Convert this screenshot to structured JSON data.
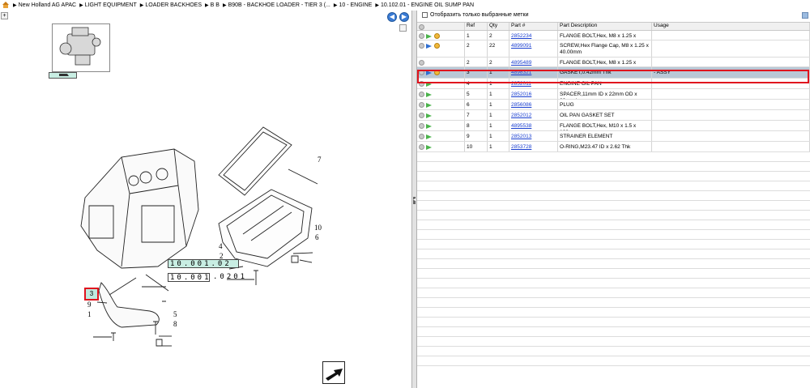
{
  "breadcrumb": [
    "New Holland AG APAC",
    "LIGHT EQUIPMENT",
    "LOADER BACKHOES",
    "B B",
    "B90B - BACKHOE LOADER - TIER 3 (...",
    "10 - ENGINE",
    "10.102.01 - ENGINE OIL SUMP PAN"
  ],
  "filter": {
    "label": "Отобразить только выбранные метки",
    "checked": false
  },
  "grid": {
    "headers": [
      "Ref",
      "Qty",
      "Part #",
      "Part Description",
      "Usage"
    ],
    "rows": [
      {
        "ref": "1",
        "qty": "2",
        "part": "2852234",
        "desc": "FLANGE BOLT,Hex, M8 x 1.25 x 20mm",
        "usage": "",
        "icons": [
          "plus",
          "green",
          "gold"
        ]
      },
      {
        "ref": "2",
        "qty": "22",
        "part": "4899091",
        "desc": "SCREW,Hex Flange Cap, M8 x 1.25 x 40.00mm",
        "usage": "",
        "icons": [
          "plus",
          "blue",
          "gold"
        ]
      },
      {
        "ref": "2",
        "qty": "2",
        "part": "4895489",
        "desc": "FLANGE BOLT,Hex, M8 x 1.25 x 110mm",
        "usage": "",
        "icons": [
          "plus"
        ]
      },
      {
        "ref": "3",
        "qty": "1",
        "part": "4898321",
        "desc": "GASKET,0.42mm Thk",
        "usage": "- ASSY",
        "icons": [
          "plus",
          "blue",
          "gold"
        ],
        "selected": true
      },
      {
        "ref": "4",
        "qty": "1",
        "part": "2852011",
        "desc": "ENGINE OIL PAN",
        "usage": "",
        "icons": [
          "plus",
          "green"
        ]
      },
      {
        "ref": "5",
        "qty": "1",
        "part": "2852016",
        "desc": "SPACER,11mm ID x 22mm OD x 39mm L",
        "usage": "",
        "icons": [
          "plus",
          "green"
        ]
      },
      {
        "ref": "6",
        "qty": "1",
        "part": "2856086",
        "desc": "PLUG",
        "usage": "",
        "icons": [
          "plus",
          "green"
        ]
      },
      {
        "ref": "7",
        "qty": "1",
        "part": "2852012",
        "desc": "OIL PAN GASKET SET",
        "usage": "",
        "icons": [
          "plus",
          "green"
        ]
      },
      {
        "ref": "8",
        "qty": "1",
        "part": "4895538",
        "desc": "FLANGE BOLT,Hex, M10 x 1.5 x 120mm",
        "usage": "",
        "icons": [
          "plus",
          "green"
        ]
      },
      {
        "ref": "9",
        "qty": "1",
        "part": "2852013",
        "desc": "STRAINER ELEMENT",
        "usage": "",
        "icons": [
          "plus",
          "green"
        ]
      },
      {
        "ref": "10",
        "qty": "1",
        "part": "2853728",
        "desc": "O-RING,M23.47 ID x 2.62 Thk",
        "usage": "",
        "icons": [
          "plus",
          "green"
        ]
      }
    ]
  },
  "diagram": {
    "callout_teal": "10.001.02",
    "callout_plain": "10.001",
    "callout_plain_suffix": ".0201",
    "highlight_ref": "3",
    "labels": {
      "n1": "1",
      "n2": "2",
      "n4": "4",
      "n5": "5",
      "n6": "6",
      "n7": "7",
      "n8": "8",
      "n9": "9",
      "n10": "10"
    }
  },
  "nav": {
    "prev": "◀",
    "next": "▶"
  },
  "colors": {
    "accent": "#3a7bd5",
    "highlight": "#e0141e",
    "teal": "#c8eee3",
    "selected_row": "#b9c8d6"
  }
}
